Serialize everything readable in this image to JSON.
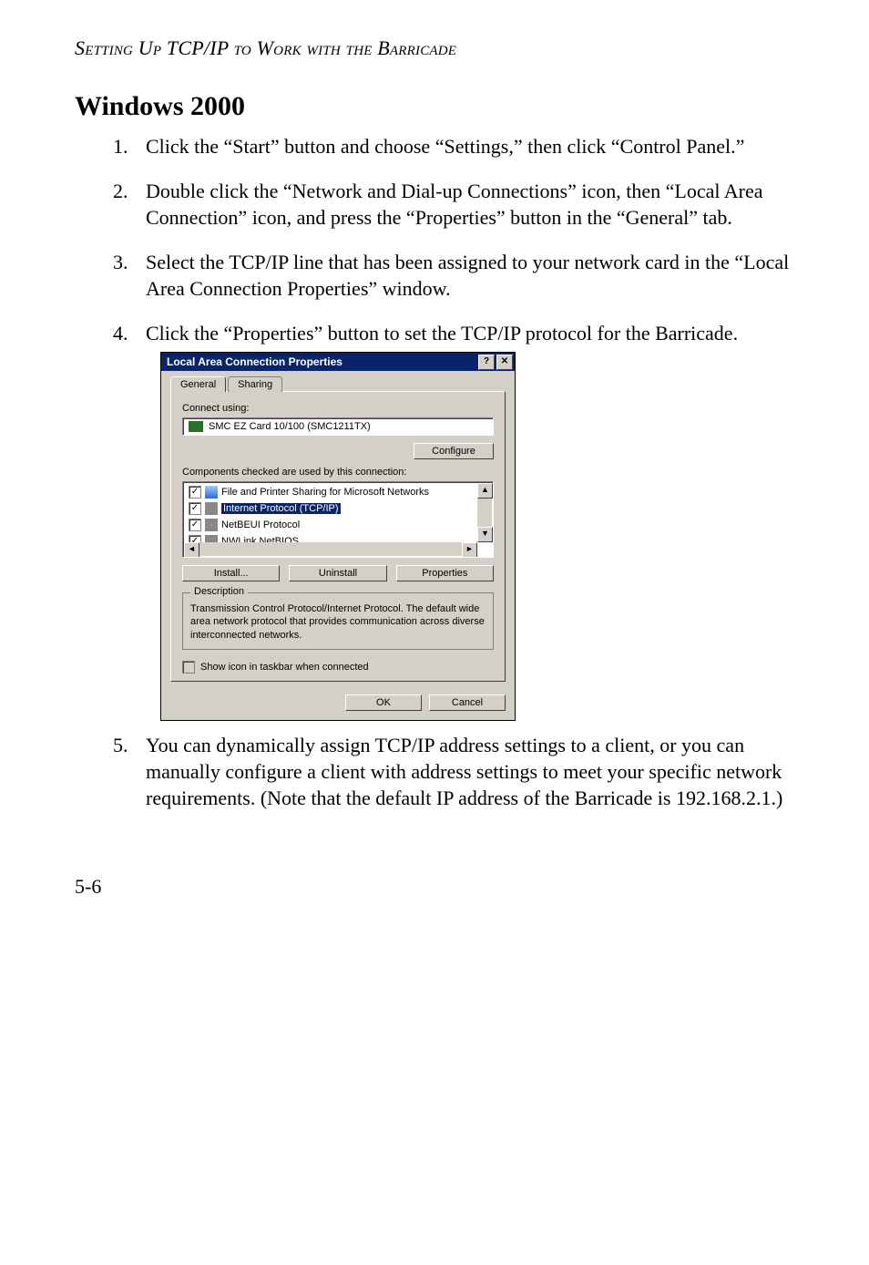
{
  "header": {
    "running": "Setting Up TCP/IP to Work with the Barricade"
  },
  "section": {
    "title": "Windows 2000"
  },
  "steps": [
    "Click the “Start” button and choose “Settings,” then click “Control Panel.”",
    "Double click the “Network and Dial-up Connections” icon, then “Local Area Connection” icon, and press the “Properties” button in the “General” tab.",
    "Select the TCP/IP line that has been assigned to your network card in the “Local Area Connection Properties” window.",
    "Click the “Properties” button to set the TCP/IP protocol for the Barricade.",
    "You can dynamically assign TCP/IP address settings to a client, or you can manually configure a client with address settings to meet your specific network requirements. (Note that the default IP address of the Barricade is 192.168.2.1.)"
  ],
  "dialog": {
    "title": "Local Area Connection Properties",
    "help_glyph": "?",
    "close_glyph": "✕",
    "tabs": {
      "general": "General",
      "sharing": "Sharing"
    },
    "connect_using_label": "Connect using:",
    "adapter": "SMC EZ Card 10/100 (SMC1211TX)",
    "configure_btn": "Configure",
    "components_label": "Components checked are used by this connection:",
    "components": [
      {
        "label": "File and Printer Sharing for Microsoft Networks",
        "checked": true,
        "selected": false
      },
      {
        "label": "Internet Protocol (TCP/IP)",
        "checked": true,
        "selected": true
      },
      {
        "label": "NetBEUI Protocol",
        "checked": true,
        "selected": false
      },
      {
        "label": "NWLink NetBIOS",
        "checked": true,
        "selected": false
      }
    ],
    "install_btn": "Install...",
    "uninstall_btn": "Uninstall",
    "properties_btn": "Properties",
    "description_legend": "Description",
    "description_text": "Transmission Control Protocol/Internet Protocol. The default wide area network protocol that provides communication across diverse interconnected networks.",
    "show_icon_label": "Show icon in taskbar when connected",
    "ok_btn": "OK",
    "cancel_btn": "Cancel",
    "scroll": {
      "up": "▲",
      "down": "▼",
      "left": "◄",
      "right": "►"
    }
  },
  "footer": {
    "page": "5-6"
  }
}
